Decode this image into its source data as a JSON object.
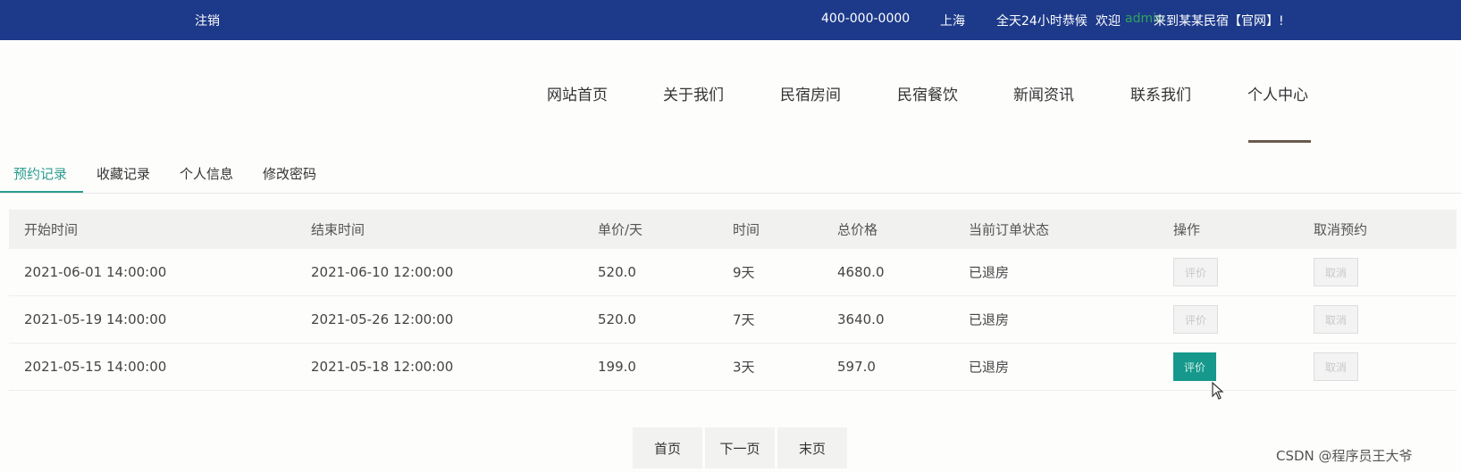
{
  "topbar": {
    "logout": "注销",
    "phone": "400-000-0000",
    "city": "上海",
    "hours": "全天24小时恭候",
    "welcome": "欢迎",
    "user": "admin",
    "welcome_tail": "来到某某民宿【官网】!"
  },
  "nav": {
    "items": [
      "网站首页",
      "关于我们",
      "民宿房间",
      "民宿餐饮",
      "新闻资讯",
      "联系我们",
      "个人中心"
    ]
  },
  "tabs": [
    "预约记录",
    "收藏记录",
    "个人信息",
    "修改密码"
  ],
  "table": {
    "headers": [
      "开始时间",
      "结束时间",
      "单价/天",
      "时间",
      "总价格",
      "当前订单状态",
      "操作",
      "取消预约"
    ],
    "rows": [
      {
        "start": "2021-06-01 14:00:00",
        "end": "2021-06-10 12:00:00",
        "price": "520.0",
        "days": "9天",
        "total": "4680.0",
        "status": "已退房",
        "op": "评价",
        "cancel": "取消"
      },
      {
        "start": "2021-05-19 14:00:00",
        "end": "2021-05-26 12:00:00",
        "price": "520.0",
        "days": "7天",
        "total": "3640.0",
        "status": "已退房",
        "op": "评价",
        "cancel": "取消"
      },
      {
        "start": "2021-05-15 14:00:00",
        "end": "2021-05-18 12:00:00",
        "price": "199.0",
        "days": "3天",
        "total": "597.0",
        "status": "已退房",
        "op": "评价",
        "cancel": "取消"
      }
    ]
  },
  "pager": {
    "first": "首页",
    "next": "下一页",
    "last": "末页"
  },
  "watermark": "CSDN @程序员王大爷",
  "colors": {
    "topbar": "#1d3a8a",
    "accent": "#2a9d8f",
    "button": "#16998c"
  }
}
